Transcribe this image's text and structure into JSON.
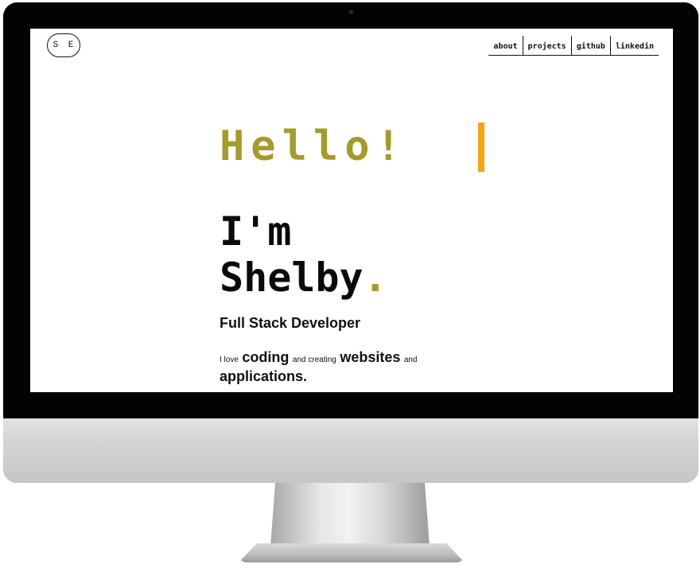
{
  "logo": {
    "text": "S E"
  },
  "nav": [
    {
      "label": "about"
    },
    {
      "label": "projects"
    },
    {
      "label": "github"
    },
    {
      "label": "linkedin"
    }
  ],
  "hero": {
    "greeting": "Hello!",
    "name_line1": "I'm",
    "name_line2": "Shelby",
    "name_dot": ".",
    "role": "Full Stack Developer",
    "tagline": {
      "part1": "I love",
      "part2": "coding",
      "part3": "and creating",
      "part4": "websites",
      "part5": "and",
      "part6": "applications."
    }
  },
  "colors": {
    "accent": "#a69a28",
    "cursor": "#f5a513",
    "text": "#0a0a0a",
    "bezel": "#030303"
  }
}
